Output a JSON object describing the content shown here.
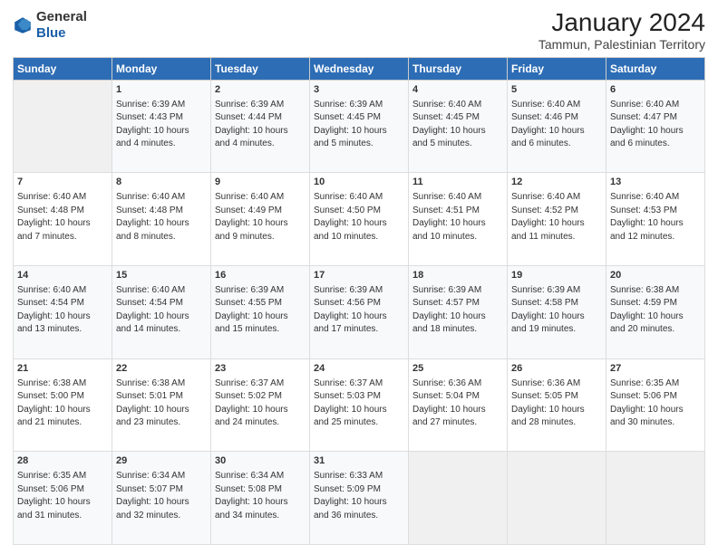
{
  "header": {
    "logo": {
      "line1": "General",
      "line2": "Blue"
    },
    "title": "January 2024",
    "subtitle": "Tammun, Palestinian Territory"
  },
  "columns": [
    "Sunday",
    "Monday",
    "Tuesday",
    "Wednesday",
    "Thursday",
    "Friday",
    "Saturday"
  ],
  "weeks": [
    [
      {
        "day": "",
        "sunrise": "",
        "sunset": "",
        "daylight": ""
      },
      {
        "day": "1",
        "sunrise": "Sunrise: 6:39 AM",
        "sunset": "Sunset: 4:43 PM",
        "daylight": "Daylight: 10 hours and 4 minutes."
      },
      {
        "day": "2",
        "sunrise": "Sunrise: 6:39 AM",
        "sunset": "Sunset: 4:44 PM",
        "daylight": "Daylight: 10 hours and 4 minutes."
      },
      {
        "day": "3",
        "sunrise": "Sunrise: 6:39 AM",
        "sunset": "Sunset: 4:45 PM",
        "daylight": "Daylight: 10 hours and 5 minutes."
      },
      {
        "day": "4",
        "sunrise": "Sunrise: 6:40 AM",
        "sunset": "Sunset: 4:45 PM",
        "daylight": "Daylight: 10 hours and 5 minutes."
      },
      {
        "day": "5",
        "sunrise": "Sunrise: 6:40 AM",
        "sunset": "Sunset: 4:46 PM",
        "daylight": "Daylight: 10 hours and 6 minutes."
      },
      {
        "day": "6",
        "sunrise": "Sunrise: 6:40 AM",
        "sunset": "Sunset: 4:47 PM",
        "daylight": "Daylight: 10 hours and 6 minutes."
      }
    ],
    [
      {
        "day": "7",
        "sunrise": "Sunrise: 6:40 AM",
        "sunset": "Sunset: 4:48 PM",
        "daylight": "Daylight: 10 hours and 7 minutes."
      },
      {
        "day": "8",
        "sunrise": "Sunrise: 6:40 AM",
        "sunset": "Sunset: 4:48 PM",
        "daylight": "Daylight: 10 hours and 8 minutes."
      },
      {
        "day": "9",
        "sunrise": "Sunrise: 6:40 AM",
        "sunset": "Sunset: 4:49 PM",
        "daylight": "Daylight: 10 hours and 9 minutes."
      },
      {
        "day": "10",
        "sunrise": "Sunrise: 6:40 AM",
        "sunset": "Sunset: 4:50 PM",
        "daylight": "Daylight: 10 hours and 10 minutes."
      },
      {
        "day": "11",
        "sunrise": "Sunrise: 6:40 AM",
        "sunset": "Sunset: 4:51 PM",
        "daylight": "Daylight: 10 hours and 10 minutes."
      },
      {
        "day": "12",
        "sunrise": "Sunrise: 6:40 AM",
        "sunset": "Sunset: 4:52 PM",
        "daylight": "Daylight: 10 hours and 11 minutes."
      },
      {
        "day": "13",
        "sunrise": "Sunrise: 6:40 AM",
        "sunset": "Sunset: 4:53 PM",
        "daylight": "Daylight: 10 hours and 12 minutes."
      }
    ],
    [
      {
        "day": "14",
        "sunrise": "Sunrise: 6:40 AM",
        "sunset": "Sunset: 4:54 PM",
        "daylight": "Daylight: 10 hours and 13 minutes."
      },
      {
        "day": "15",
        "sunrise": "Sunrise: 6:40 AM",
        "sunset": "Sunset: 4:54 PM",
        "daylight": "Daylight: 10 hours and 14 minutes."
      },
      {
        "day": "16",
        "sunrise": "Sunrise: 6:39 AM",
        "sunset": "Sunset: 4:55 PM",
        "daylight": "Daylight: 10 hours and 15 minutes."
      },
      {
        "day": "17",
        "sunrise": "Sunrise: 6:39 AM",
        "sunset": "Sunset: 4:56 PM",
        "daylight": "Daylight: 10 hours and 17 minutes."
      },
      {
        "day": "18",
        "sunrise": "Sunrise: 6:39 AM",
        "sunset": "Sunset: 4:57 PM",
        "daylight": "Daylight: 10 hours and 18 minutes."
      },
      {
        "day": "19",
        "sunrise": "Sunrise: 6:39 AM",
        "sunset": "Sunset: 4:58 PM",
        "daylight": "Daylight: 10 hours and 19 minutes."
      },
      {
        "day": "20",
        "sunrise": "Sunrise: 6:38 AM",
        "sunset": "Sunset: 4:59 PM",
        "daylight": "Daylight: 10 hours and 20 minutes."
      }
    ],
    [
      {
        "day": "21",
        "sunrise": "Sunrise: 6:38 AM",
        "sunset": "Sunset: 5:00 PM",
        "daylight": "Daylight: 10 hours and 21 minutes."
      },
      {
        "day": "22",
        "sunrise": "Sunrise: 6:38 AM",
        "sunset": "Sunset: 5:01 PM",
        "daylight": "Daylight: 10 hours and 23 minutes."
      },
      {
        "day": "23",
        "sunrise": "Sunrise: 6:37 AM",
        "sunset": "Sunset: 5:02 PM",
        "daylight": "Daylight: 10 hours and 24 minutes."
      },
      {
        "day": "24",
        "sunrise": "Sunrise: 6:37 AM",
        "sunset": "Sunset: 5:03 PM",
        "daylight": "Daylight: 10 hours and 25 minutes."
      },
      {
        "day": "25",
        "sunrise": "Sunrise: 6:36 AM",
        "sunset": "Sunset: 5:04 PM",
        "daylight": "Daylight: 10 hours and 27 minutes."
      },
      {
        "day": "26",
        "sunrise": "Sunrise: 6:36 AM",
        "sunset": "Sunset: 5:05 PM",
        "daylight": "Daylight: 10 hours and 28 minutes."
      },
      {
        "day": "27",
        "sunrise": "Sunrise: 6:35 AM",
        "sunset": "Sunset: 5:06 PM",
        "daylight": "Daylight: 10 hours and 30 minutes."
      }
    ],
    [
      {
        "day": "28",
        "sunrise": "Sunrise: 6:35 AM",
        "sunset": "Sunset: 5:06 PM",
        "daylight": "Daylight: 10 hours and 31 minutes."
      },
      {
        "day": "29",
        "sunrise": "Sunrise: 6:34 AM",
        "sunset": "Sunset: 5:07 PM",
        "daylight": "Daylight: 10 hours and 32 minutes."
      },
      {
        "day": "30",
        "sunrise": "Sunrise: 6:34 AM",
        "sunset": "Sunset: 5:08 PM",
        "daylight": "Daylight: 10 hours and 34 minutes."
      },
      {
        "day": "31",
        "sunrise": "Sunrise: 6:33 AM",
        "sunset": "Sunset: 5:09 PM",
        "daylight": "Daylight: 10 hours and 36 minutes."
      },
      {
        "day": "",
        "sunrise": "",
        "sunset": "",
        "daylight": ""
      },
      {
        "day": "",
        "sunrise": "",
        "sunset": "",
        "daylight": ""
      },
      {
        "day": "",
        "sunrise": "",
        "sunset": "",
        "daylight": ""
      }
    ]
  ]
}
